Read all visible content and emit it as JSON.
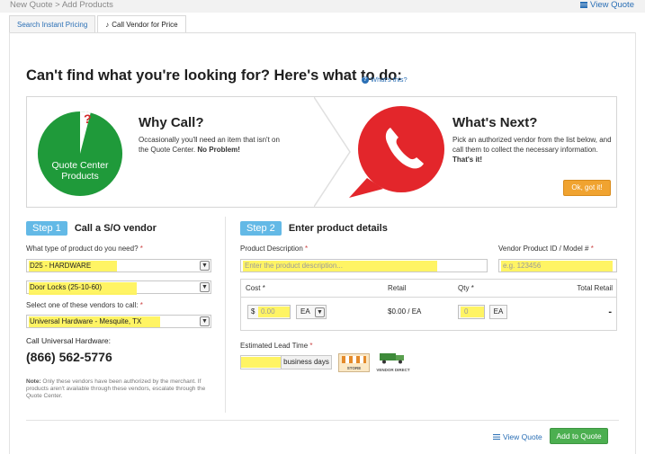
{
  "header": {
    "breadcrumb": "New Quote > Add Products",
    "view_quote": "View Quote"
  },
  "tabs": [
    {
      "label": "Search Instant Pricing",
      "active": false
    },
    {
      "label": "Call Vendor for Price",
      "active": true
    }
  ],
  "headline": "Can't find what you're looking for? Here's what to do:",
  "whats_this": "What's this?",
  "banner": {
    "pie_label_line1": "Quote Center",
    "pie_label_line2": "Products",
    "pie_mark": "?",
    "why_title": "Why Call?",
    "why_body": "Occasionally you'll need an item that isn't on the Quote Center.",
    "why_body_bold": "No Problem!",
    "next_title": "What's Next?",
    "next_body": "Pick an authorized vendor from the list below, and call them to collect the necessary information.",
    "next_body_bold": "That's it!",
    "ok_button": "Ok, got it!"
  },
  "step1": {
    "badge": "Step 1",
    "title": "Call a S/O vendor",
    "product_type_label": "What type of product do you need?",
    "product_type_value": "D25 - HARDWARE",
    "subcategory_value": "Door Locks (25-10-60)",
    "vendor_label": "Select one of these vendors to call:",
    "vendor_value": "Universal Hardware - Mesquite, TX",
    "call_label": "Call Universal Hardware:",
    "phone": "(866) 562-5776",
    "note_prefix": "Note:",
    "note": "Only these vendors have been authorized by the merchant. If products aren't available through these vendors, escalate through the Quote Center."
  },
  "step2": {
    "badge": "Step 2",
    "title": "Enter product details",
    "desc_label": "Product Description",
    "desc_placeholder": "Enter the product description...",
    "vendor_id_label": "Vendor Product ID / Model #",
    "vendor_id_placeholder": "e.g. 123456",
    "cost_header": "Cost",
    "retail_header": "Retail",
    "qty_header": "Qty",
    "total_header": "Total Retail",
    "currency": "$",
    "cost_value": "0.00",
    "unit": "EA",
    "retail_value": "$0.00 / EA",
    "qty_value": "0",
    "qty_unit": "EA",
    "total_value": "-",
    "lead_time_label": "Estimated Lead Time",
    "lead_time_unit": "business days",
    "store_label": "STORE",
    "vendor_direct_label": "VENDOR DIRECT"
  },
  "footer": {
    "view_quote": "View Quote",
    "add_button": "Add to Quote"
  },
  "colors": {
    "pie_green": "#1f9a3a",
    "bubble_red": "#e3262b",
    "step_badge": "#63b9e6",
    "ok_orange": "#f0a330",
    "add_green": "#4caf50",
    "highlight": "#fff35c",
    "link_blue": "#2a6fb5"
  }
}
